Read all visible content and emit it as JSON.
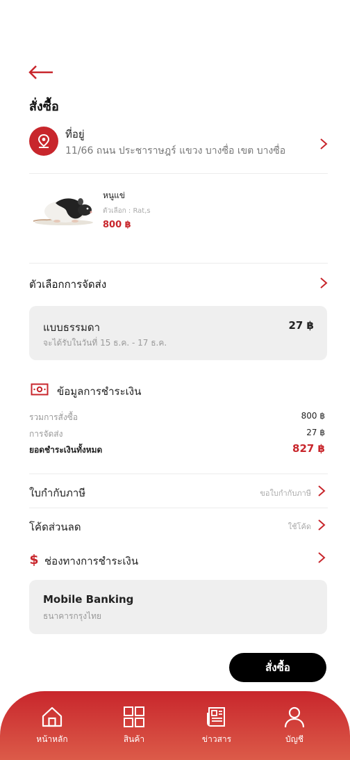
{
  "header": {
    "title": "สั่งซื้อ"
  },
  "address": {
    "label": "ที่อยู่",
    "text": "11/66 ถนน ประชาราษฎร์ แขวง บางซื่อ เขต บางซื่อ"
  },
  "product": {
    "name": "หนูแข่",
    "option": "ตัวเลือก : Rat,s",
    "price": "800 ฿"
  },
  "shipping": {
    "title": "ตัวเลือกการจัดส่ง",
    "method": "แบบธรรมดา",
    "price": "27 ฿",
    "eta": "จะได้รับในวันที่ 15 ธ.ค. - 17 ธ.ค."
  },
  "payment_info": {
    "title": "ข้อมูลการชำระเงิน",
    "rows": [
      {
        "label": "รวมการสั่งซื้อ",
        "value": "800 ฿"
      },
      {
        "label": "การจัดส่ง",
        "value": "27 ฿"
      }
    ],
    "total_label": "ยอดชำระเงินทั้งหมด",
    "total_value": "827 ฿"
  },
  "tax_invoice": {
    "label": "ใบกำกับภาษี",
    "action": "ขอใบกำกับภาษี"
  },
  "discount": {
    "label": "โค้ดส่วนลด",
    "action": "ใช้โค้ด"
  },
  "payment_channel": {
    "label": "ช่องทางการชำระเงิน",
    "method": "Mobile Banking",
    "bank": "ธนาคารกรุงไทย"
  },
  "order_button": "สั่งซื้อ",
  "nav": {
    "items": [
      {
        "label": "หน้าหลัก",
        "icon": "home-icon"
      },
      {
        "label": "สินค้า",
        "icon": "grid-icon"
      },
      {
        "label": "ข่าวสาร",
        "icon": "newspaper-icon"
      },
      {
        "label": "บัญชี",
        "icon": "user-icon"
      }
    ]
  },
  "colors": {
    "accent": "#c8262c",
    "card": "#efefef",
    "button": "#000000"
  }
}
